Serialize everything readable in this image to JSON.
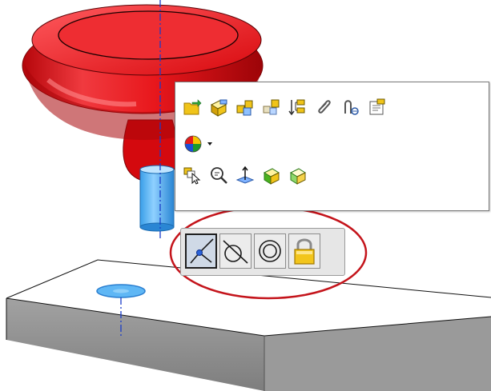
{
  "colors": {
    "knob": "#e8171c",
    "cylinder": "#3aa6ee",
    "plate_top": "#ffffff",
    "plate_side": "#8e8e8e",
    "axis": "#1a3cc8",
    "highlight_ellipse": "#c4141b"
  },
  "context_toolbar": {
    "row1_icons": [
      "open-part-icon",
      "edit-component-icon",
      "hide-components-icon",
      "isolate-icon",
      "component-tree-icon",
      "paperclip-icon",
      "view-mates-icon",
      "properties-icon"
    ],
    "row2_icons": [
      "appearance-dropdown-icon"
    ],
    "row3_icons": [
      "select-other-icon",
      "zoom-to-selection-icon",
      "normal-to-icon",
      "edit-solid-icon",
      "transparency-icon"
    ]
  },
  "mate_toolbar": {
    "buttons": [
      {
        "icon": "coincident-mate-icon",
        "pressed": true
      },
      {
        "icon": "tangent-mate-icon",
        "pressed": false
      },
      {
        "icon": "concentric-mate-icon",
        "pressed": false
      },
      {
        "icon": "lock-mate-icon",
        "pressed": false
      }
    ]
  }
}
